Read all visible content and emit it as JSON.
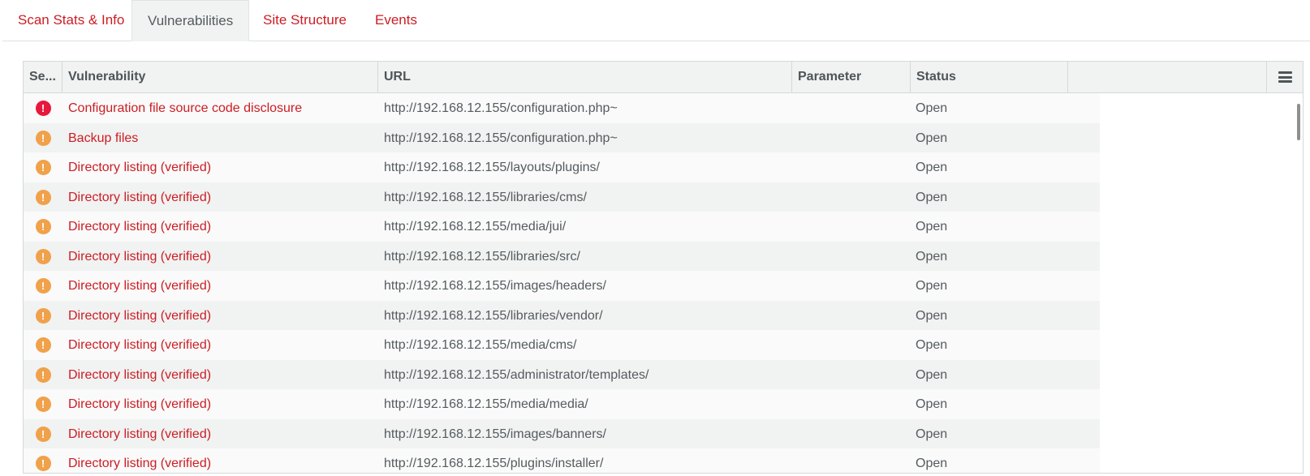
{
  "tabs": [
    {
      "label": "Scan Stats & Info"
    },
    {
      "label": "Vulnerabilities"
    },
    {
      "label": "Site Structure"
    },
    {
      "label": "Events"
    }
  ],
  "active_tab": "Vulnerabilities",
  "table": {
    "columns": [
      "Se...",
      "Vulnerability",
      "URL",
      "Parameter",
      "Status"
    ],
    "menu_icon": "hamburger-menu-icon",
    "rows": [
      {
        "severity": "high",
        "vulnerability": "Configuration file source code disclosure",
        "url": "http://192.168.12.155/configuration.php~",
        "parameter": "",
        "status": "Open"
      },
      {
        "severity": "medium",
        "vulnerability": "Backup files",
        "url": "http://192.168.12.155/configuration.php~",
        "parameter": "",
        "status": "Open"
      },
      {
        "severity": "medium",
        "vulnerability": "Directory listing (verified)",
        "url": "http://192.168.12.155/layouts/plugins/",
        "parameter": "",
        "status": "Open"
      },
      {
        "severity": "medium",
        "vulnerability": "Directory listing (verified)",
        "url": "http://192.168.12.155/libraries/cms/",
        "parameter": "",
        "status": "Open"
      },
      {
        "severity": "medium",
        "vulnerability": "Directory listing (verified)",
        "url": "http://192.168.12.155/media/jui/",
        "parameter": "",
        "status": "Open"
      },
      {
        "severity": "medium",
        "vulnerability": "Directory listing (verified)",
        "url": "http://192.168.12.155/libraries/src/",
        "parameter": "",
        "status": "Open"
      },
      {
        "severity": "medium",
        "vulnerability": "Directory listing (verified)",
        "url": "http://192.168.12.155/images/headers/",
        "parameter": "",
        "status": "Open"
      },
      {
        "severity": "medium",
        "vulnerability": "Directory listing (verified)",
        "url": "http://192.168.12.155/libraries/vendor/",
        "parameter": "",
        "status": "Open"
      },
      {
        "severity": "medium",
        "vulnerability": "Directory listing (verified)",
        "url": "http://192.168.12.155/media/cms/",
        "parameter": "",
        "status": "Open"
      },
      {
        "severity": "medium",
        "vulnerability": "Directory listing (verified)",
        "url": "http://192.168.12.155/administrator/templates/",
        "parameter": "",
        "status": "Open"
      },
      {
        "severity": "medium",
        "vulnerability": "Directory listing (verified)",
        "url": "http://192.168.12.155/media/media/",
        "parameter": "",
        "status": "Open"
      },
      {
        "severity": "medium",
        "vulnerability": "Directory listing (verified)",
        "url": "http://192.168.12.155/images/banners/",
        "parameter": "",
        "status": "Open"
      },
      {
        "severity": "medium",
        "vulnerability": "Directory listing (verified)",
        "url": "http://192.168.12.155/plugins/installer/",
        "parameter": "",
        "status": "Open"
      }
    ]
  },
  "colors": {
    "accent_red": "#cc1d23",
    "severity_high": "#e8173c",
    "severity_medium": "#f0a14a"
  },
  "severity_icons": {
    "high": "exclamation-circle-icon",
    "medium": "exclamation-circle-icon"
  }
}
